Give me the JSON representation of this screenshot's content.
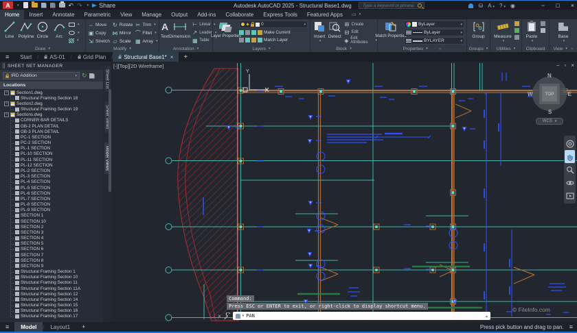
{
  "window": {
    "title": "Autodesk AutoCAD 2025 - Structural Base1.dwg",
    "share_label": "Share",
    "search_placeholder": "Type a keyword or phrase"
  },
  "ribbon": {
    "tabs": [
      {
        "label": "Home",
        "active": true
      },
      {
        "label": "Insert"
      },
      {
        "label": "Annotate"
      },
      {
        "label": "Parametric"
      },
      {
        "label": "View"
      },
      {
        "label": "Manage"
      },
      {
        "label": "Output"
      },
      {
        "label": "Add-ins"
      },
      {
        "label": "Collaborate"
      },
      {
        "label": "Express Tools"
      },
      {
        "label": "Featured Apps"
      }
    ],
    "panels": {
      "draw": {
        "label": "Draw",
        "tools": [
          "Line",
          "Polyline",
          "Circle",
          "Arc"
        ]
      },
      "modify": {
        "label": "Modify",
        "tools": [
          "Move",
          "Rotate",
          "Trim",
          "Copy",
          "Mirror",
          "Fillet",
          "Stretch",
          "Scale",
          "Array"
        ]
      },
      "annotation": {
        "label": "Annotation",
        "text": "Text",
        "dimension": "Dimension",
        "small": [
          "Linear",
          "Leader",
          "Table"
        ]
      },
      "layers": {
        "label": "Layers",
        "big": "Layer Properties",
        "combo_value": "0",
        "row1": "Make Current",
        "row2": "Match Layer"
      },
      "block": {
        "label": "Block",
        "insert": "Insert",
        "detect": "Detect",
        "small": [
          "Create",
          "Edit",
          "Edit Attributes"
        ]
      },
      "properties": {
        "label": "Properties",
        "big": "Match Properties",
        "combo1": "ByLayer",
        "combo2": "ByLayer",
        "combo3": "BYLAYER"
      },
      "groups": {
        "label": "Groups",
        "big": "Group"
      },
      "utilities": {
        "label": "Utilities",
        "big": "Measure"
      },
      "clipboard": {
        "label": "Clipboard",
        "big": "Paste"
      },
      "view": {
        "label": "View",
        "big": "Base"
      }
    }
  },
  "file_tabs": {
    "items": [
      {
        "label": "Start",
        "locked": false,
        "active": false
      },
      {
        "label": "AS-01",
        "locked": true,
        "active": false
      },
      {
        "label": "Grid Plan",
        "locked": true,
        "active": false
      },
      {
        "label": "Structural Base1*",
        "locked": true,
        "active": true
      }
    ]
  },
  "sheet_set_manager": {
    "title": "SHEET SET MANAGER",
    "dropdown_value": "IRD Addition",
    "locations_label": "Locations",
    "side_tabs": [
      {
        "label": "Sheet List",
        "active": false
      },
      {
        "label": "Sheet Views",
        "active": false
      },
      {
        "label": "Model Views",
        "active": true
      }
    ],
    "tree": [
      {
        "label": "Section1.dwg",
        "children": [
          "Structural Framing Section 18"
        ]
      },
      {
        "label": "Section2.dwg",
        "children": [
          "Structural Framing Section 19"
        ]
      },
      {
        "label": "Sections.dwg",
        "children": [
          "CORNER BAR DETAILS",
          "GB-2 PLAN DETAIL",
          "GB-3 PLAN DETAIL",
          "PC-1 SECTION",
          "PC-2 SECTION",
          "PL-1 SECTION",
          "PL-10 SECTION",
          "PL-11 SECTION",
          "PL-12 SECTION",
          "PL-2 SECTION",
          "PL-3 SECTION",
          "PL-4 SECTION",
          "PL-5 SECTION",
          "PL-6 SECTION",
          "PL-7 SECTION",
          "PL-8 SECTION",
          "PL-9 SECTION",
          "SECTION 1",
          "SECTION 10",
          "SECTION 2",
          "SECTION 3",
          "SECTION 4",
          "SECTION 5",
          "SECTION 6",
          "SECTION 7",
          "SECTION 8",
          "SECTION 9",
          "Structural Framing Section 1",
          "Structural Framing Section 10",
          "Structural Framing Section 11",
          "Structural Framing Section 11A",
          "Structural Framing Section 12",
          "Structural Framing Section 14",
          "Structural Framing Section 15",
          "Structural Framing Section 16",
          "Structural Framing Section 17"
        ]
      }
    ]
  },
  "viewport": {
    "label": "[-][Top][2D Wireframe]",
    "viewcube": {
      "n": "N",
      "s": "S",
      "e": "E",
      "w": "W",
      "top": "TOP",
      "wcs": "WCS"
    }
  },
  "command": {
    "prompt": "Command:",
    "message": "Press ESC or ENTER to exit, or right-click to display shortcut menu.",
    "input": "PAN"
  },
  "layout_tabs": {
    "items": [
      {
        "label": "Model",
        "active": true
      },
      {
        "label": "Layout1",
        "active": false
      }
    ]
  },
  "status_bar": {
    "hint": "Press pick button and drag to pan."
  },
  "watermark": "© FileInfo.com",
  "colors": {
    "accent_blue": "#1b74d8",
    "grid_teal": "#43b6ad",
    "column_orange": "#b06a32",
    "hatch_red": "#9e2a2f",
    "annotation_blue": "#3050ff",
    "green": "#257a46",
    "canvas_bg": "#22272f"
  }
}
